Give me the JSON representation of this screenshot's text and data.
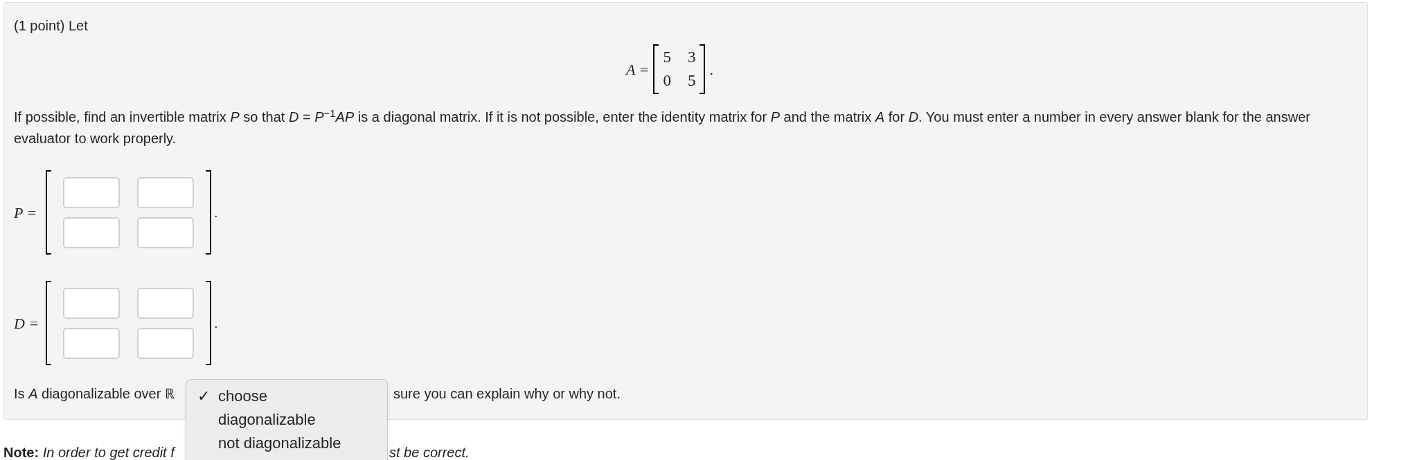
{
  "intro": "(1 point) Let",
  "matrix_a": {
    "label": "A =",
    "rows": [
      [
        "5",
        "3"
      ],
      [
        "0",
        "5"
      ]
    ],
    "end": "."
  },
  "instructions": "If possible, find an invertible matrix *P* so that *D* = *P*$^{−1}$*AP* is a diagonal matrix. If it is not possible, enter the identity matrix for *P* and the matrix *A* for *D*. You must enter a number in every answer blank for the answer evaluator to work properly.",
  "answer_matrices": [
    {
      "label": "P =",
      "end": ".",
      "cells": [
        [
          {
            "kind": "input"
          },
          {
            "kind": "input"
          }
        ],
        [
          {
            "kind": "input"
          },
          {
            "kind": "input"
          }
        ]
      ]
    },
    {
      "label": "D =",
      "end": ".",
      "cells": [
        [
          {
            "kind": "input"
          },
          {
            "kind": "input"
          }
        ],
        [
          {
            "kind": "input"
          },
          {
            "kind": "input"
          }
        ]
      ]
    }
  ],
  "question": {
    "before": "Is *A* diagonalizable over ℝ",
    "after": "sure you can explain why or why not."
  },
  "dropdown": {
    "check_mark": "✓",
    "options": [
      {
        "label": "choose",
        "selected": true
      },
      {
        "label": "diagonalizable",
        "selected": false
      },
      {
        "label": "not diagonalizable",
        "selected": false
      }
    ]
  },
  "note": {
    "before": "**Note:** *In order to get credit f*",
    "after": "st be correct."
  }
}
